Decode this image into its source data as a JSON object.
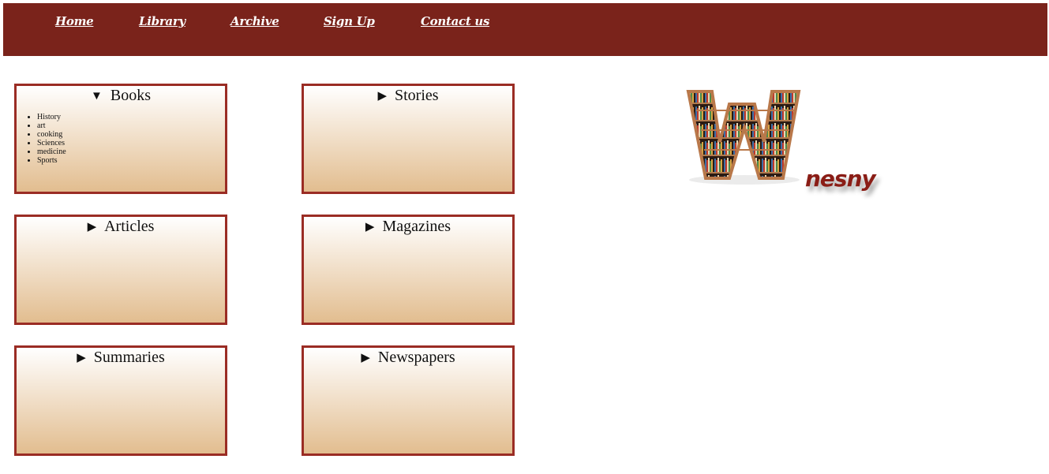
{
  "nav": {
    "items": [
      "Home",
      "Library",
      "Archive",
      "Sign Up ",
      "Contact us"
    ]
  },
  "categories": [
    {
      "label": "Books",
      "open": true,
      "items": [
        "History",
        "art",
        "cooking",
        "Sciences",
        "medicine",
        "Sports"
      ]
    },
    {
      "label": "Stories",
      "open": false
    },
    {
      "label": "Articles",
      "open": false
    },
    {
      "label": "Magazines",
      "open": false
    },
    {
      "label": "Summaries",
      "open": false
    },
    {
      "label": "Newspapers",
      "open": false
    }
  ],
  "icons": {
    "expanded": "triangle-down-icon",
    "collapsed": "triangle-right-icon"
  },
  "logo": {
    "tail_text": "nesny"
  },
  "colors": {
    "navbar": "#7a231b",
    "box_border": "#9a2c24",
    "box_gradient_bottom": "#e2bd8f",
    "logo_text": "#8a1d16"
  }
}
